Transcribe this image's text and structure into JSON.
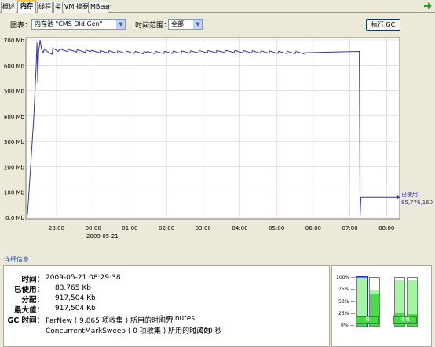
{
  "tabs": [
    "概述",
    "内存",
    "线程",
    "类",
    "VM 摘要",
    "MBean"
  ],
  "active_tab": "内存",
  "controls": {
    "chart_label": "图表：",
    "chart_value": "内存池 \"CMS Old Gen\"",
    "range_label": "时间范围：",
    "range_value": "全部",
    "gc_button": "执行 GC"
  },
  "chart_data": {
    "type": "line",
    "yticks": [
      "0.0 Mb",
      "100 Mb",
      "200 Mb",
      "300 Mb",
      "400 Mb",
      "500 Mb",
      "600 Mb",
      "700 Mb"
    ],
    "xticks": [
      "23:00",
      "00:00",
      "01:00",
      "02:00",
      "03:00",
      "04:00",
      "05:00",
      "06:00",
      "07:00",
      "08:00"
    ],
    "date_label": "2009-05-21",
    "ylim": [
      0,
      700
    ],
    "series": [
      {
        "values_mb": [
          [
            0,
            10
          ],
          [
            4,
            200
          ],
          [
            8,
            400
          ],
          [
            11,
            600
          ],
          [
            12,
            690
          ],
          [
            13,
            530
          ],
          [
            14,
            650
          ],
          [
            16,
            700
          ],
          [
            17,
            680
          ],
          [
            18,
            660
          ],
          [
            20,
            650
          ],
          [
            40,
            660
          ],
          [
            80,
            655
          ],
          [
            150,
            650
          ],
          [
            250,
            655
          ],
          [
            350,
            650
          ],
          [
            419,
            655
          ],
          [
            420,
            5
          ],
          [
            421,
            80
          ],
          [
            470,
            80
          ]
        ]
      }
    ],
    "current_label": "已使用",
    "current_value": "85,776,160"
  },
  "details": {
    "title": "详细信息",
    "time_label": "时间：",
    "time_value": "2009-05-21 08:29:38",
    "used_label": "已使用：",
    "used_value": "83,765 Kb",
    "committed_label": "分配：",
    "committed_value": "917,504 Kb",
    "max_label": "最大值：",
    "max_value": "917,504 Kb",
    "gc_label": "GC 时间：",
    "gc1": "ParNew ( 9,865 项收集 ) 所用的时间为",
    "gc1_time": "2 minutes",
    "gc2": "ConcurrentMarkSweep ( 0 项收集 ) 所用的时间为",
    "gc2_time": "0.000 秒"
  },
  "gauges": {
    "ylabels": [
      "100% —",
      "75% —",
      "50% —",
      "25% —",
      "0% —"
    ],
    "heap_label": "堆",
    "nonheap_label": "非堆",
    "bars": [
      {
        "used": 0.09,
        "committed": 1.0
      },
      {
        "used": 0.68,
        "committed": 0.75
      },
      {
        "used": 0.27,
        "committed": 0.95
      },
      {
        "used": 0.24,
        "committed": 0.95
      }
    ]
  },
  "colors": {
    "line": "#3333aa",
    "fill": "#4ddb4d"
  }
}
